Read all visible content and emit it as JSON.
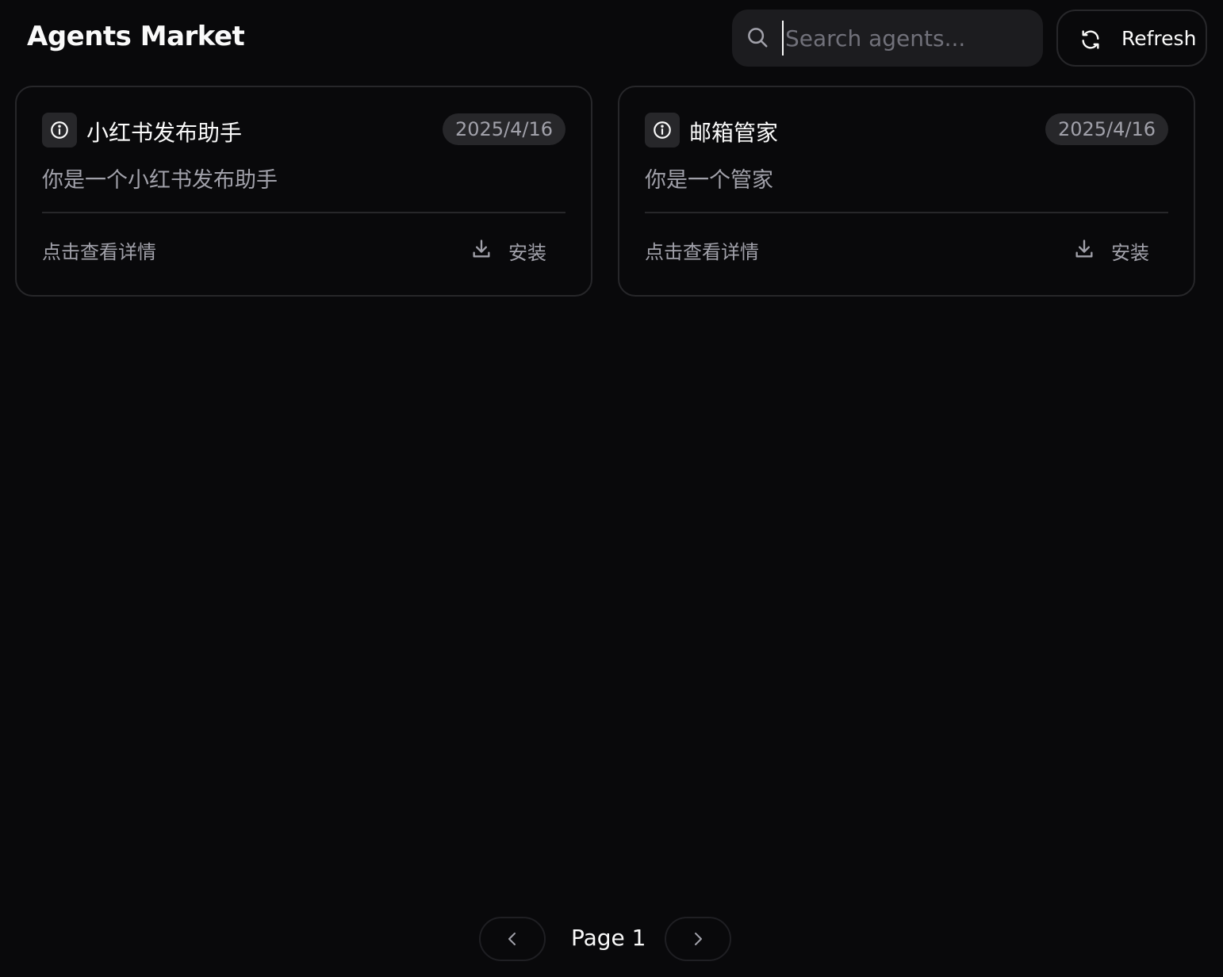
{
  "header": {
    "title": "Agents Market"
  },
  "search": {
    "placeholder": "Search agents...",
    "value": ""
  },
  "toolbar": {
    "refresh_label": "Refresh"
  },
  "agents": [
    {
      "name": "小红书发布助手",
      "date": "2025/4/16",
      "description": "你是一个小红书发布助手",
      "details_label": "点击查看详情",
      "install_label": "安装"
    },
    {
      "name": "邮箱管家",
      "date": "2025/4/16",
      "description": "你是一个管家",
      "details_label": "点击查看详情",
      "install_label": "安装"
    }
  ],
  "pagination": {
    "label": "Page 1"
  },
  "icons": {
    "search": "search-icon",
    "refresh": "refresh-icon",
    "info": "info-icon",
    "download": "download-icon",
    "prev": "chevron-left-icon",
    "next": "chevron-right-icon"
  },
  "colors": {
    "background": "#09090b",
    "border": "#27272a",
    "muted_text": "#a1a1aa",
    "text": "#fafafa"
  }
}
